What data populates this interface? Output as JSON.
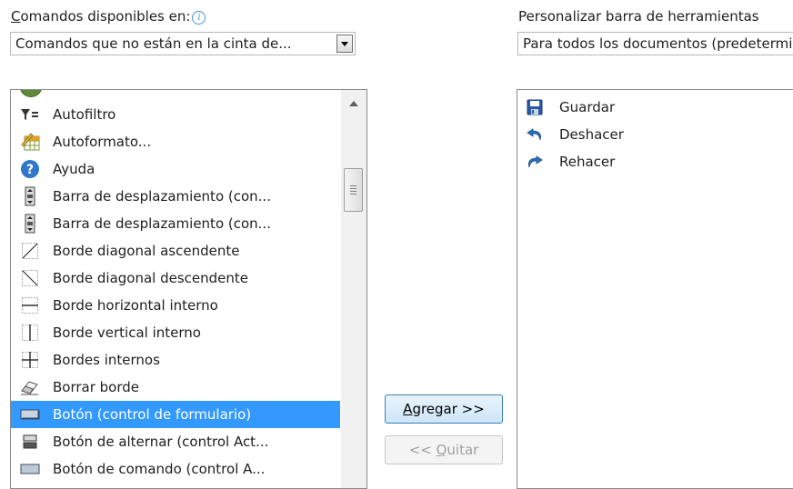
{
  "left_panel": {
    "label_prefix": "C",
    "label_rest": "omandos disponibles en:",
    "info_glyph": "i",
    "dropdown_value": "Comandos que no están en la cinta de..."
  },
  "right_panel": {
    "label": "Personalizar barra de herramientas",
    "dropdown_value": "Para todos los documentos (predeterminado)"
  },
  "commands": [
    {
      "label": "Autofiltro",
      "icon": "filter-icon"
    },
    {
      "label": "Autoformato...",
      "icon": "autoformat-icon"
    },
    {
      "label": "Ayuda",
      "icon": "help-icon"
    },
    {
      "label": "Barra de desplazamiento (con...",
      "icon": "scrollbar-control-icon"
    },
    {
      "label": "Barra de desplazamiento (con...",
      "icon": "scrollbar-control-icon"
    },
    {
      "label": "Borde diagonal ascendente",
      "icon": "border-diagonal-up-icon"
    },
    {
      "label": "Borde diagonal descendente",
      "icon": "border-diagonal-down-icon"
    },
    {
      "label": "Borde horizontal interno",
      "icon": "border-inside-horizontal-icon"
    },
    {
      "label": "Borde vertical interno",
      "icon": "border-inside-vertical-icon"
    },
    {
      "label": "Bordes internos",
      "icon": "border-inside-icon"
    },
    {
      "label": "Borrar borde",
      "icon": "eraser-icon"
    },
    {
      "label": "Botón (control de formulario)",
      "icon": "form-button-icon",
      "selected": true
    },
    {
      "label": "Botón de alternar (control Act...",
      "icon": "toggle-button-icon"
    },
    {
      "label": "Botón de comando (control A...",
      "icon": "command-button-icon"
    }
  ],
  "buttons": {
    "add_mnemonic": "A",
    "add_rest": "gregar >>",
    "remove_prefix": "<< ",
    "remove_mnemonic": "Q",
    "remove_rest": "uitar"
  },
  "toolbar_items": [
    {
      "label": "Guardar",
      "icon": "save-icon"
    },
    {
      "label": "Deshacer",
      "icon": "undo-icon"
    },
    {
      "label": "Rehacer",
      "icon": "redo-icon"
    }
  ],
  "colors": {
    "selection": "#3399ff",
    "icon_blue": "#2f6fb7"
  }
}
